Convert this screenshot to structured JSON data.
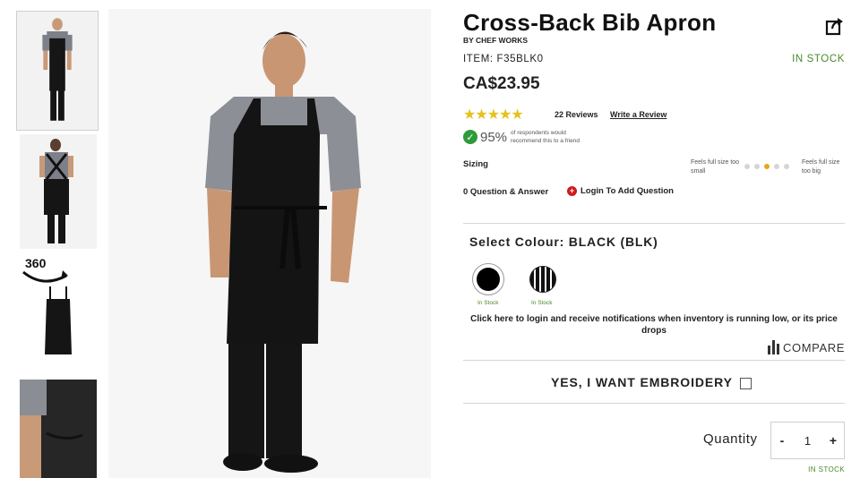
{
  "product": {
    "title": "Cross-Back Bib Apron",
    "brand": "BY CHEF WORKS",
    "item": "ITEM: F35BLK0",
    "stock_status": "IN STOCK",
    "price": "CA$23.95"
  },
  "reviews": {
    "stars": "★★★★★",
    "rating": 5,
    "count_text": "22 Reviews",
    "write_review": "Write a Review"
  },
  "recommend": {
    "percent": "95%",
    "text": "of respondents would recommend this to a friend"
  },
  "sizing": {
    "label": "Sizing",
    "left_label": "Feels full size too small",
    "right_label": "Feels full size too big",
    "position_index": 2,
    "dot_count": 5
  },
  "qa": {
    "count_text": "0 Question & Answer",
    "login_text": "Login To Add Question"
  },
  "colour": {
    "label": "Select Colour: BLACK (BLK)",
    "swatches": [
      {
        "name": "Black",
        "stock": "In Stock",
        "selected": true
      },
      {
        "name": "Black Pinstripe",
        "stock": "In Stock",
        "selected": false
      }
    ]
  },
  "notify_text": "Click here to login and receive notifications when inventory is running low, or its price drops",
  "compare_text": "COMPARE",
  "embroidery_text": "YES, I WANT EMBROIDERY",
  "quantity": {
    "label": "Quantity",
    "minus": "-",
    "value": "1",
    "plus": "+",
    "stock": "IN STOCK"
  },
  "gallery": {
    "badge_360": "360"
  },
  "colors": {
    "accent_green": "#4a8a2a",
    "star_yellow": "#e5c21c",
    "sizing_active": "#f0a21a",
    "login_red": "#d01a1a"
  }
}
